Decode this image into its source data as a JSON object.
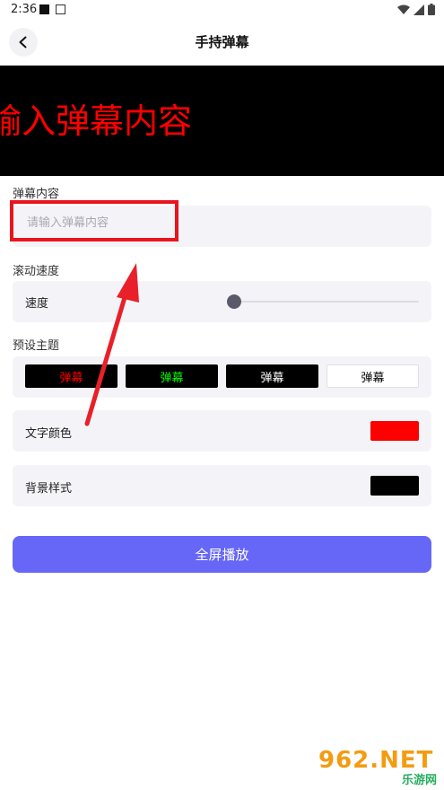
{
  "status_bar": {
    "time": "2:36"
  },
  "header": {
    "title": "手持弹幕"
  },
  "preview": {
    "text": "输入弹幕内容",
    "text_color": "#ff0000",
    "bg_color": "#000000"
  },
  "content_section": {
    "label": "弹幕内容",
    "input_placeholder": "请输入弹幕内容",
    "input_value": ""
  },
  "speed_section": {
    "label": "滚动速度",
    "row_label": "速度",
    "value": 0.0
  },
  "theme_section": {
    "label": "预设主题",
    "themes": [
      {
        "label": "弹幕",
        "text_color": "#ff0000",
        "bg_color": "#000000"
      },
      {
        "label": "弹幕",
        "text_color": "#00ff00",
        "bg_color": "#000000"
      },
      {
        "label": "弹幕",
        "text_color": "#ffffff",
        "bg_color": "#000000"
      },
      {
        "label": "弹幕",
        "text_color": "#000000",
        "bg_color": "#ffffff"
      }
    ]
  },
  "text_color_row": {
    "label": "文字颜色",
    "color": "#ff0000"
  },
  "bg_style_row": {
    "label": "背景样式",
    "color": "#000000"
  },
  "play_button": {
    "label": "全屏播放"
  },
  "watermark": {
    "main": "962.NET",
    "sub": "乐游网"
  }
}
